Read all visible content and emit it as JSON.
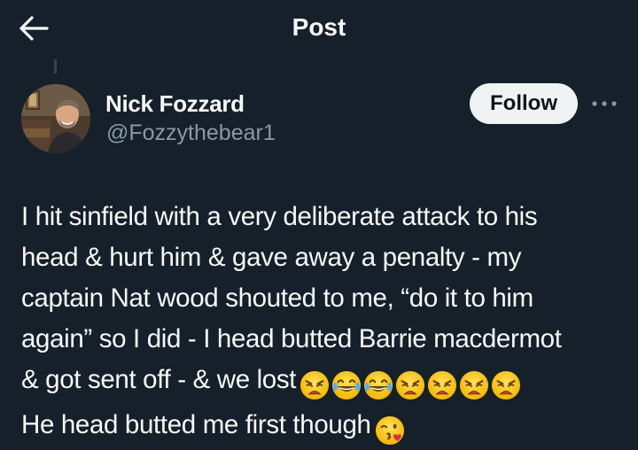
{
  "header": {
    "title": "Post",
    "back_icon": "arrow-left-icon"
  },
  "author": {
    "display_name": "Nick Fozzard",
    "handle": "@Fozzythebear1",
    "avatar_icon": "user-avatar"
  },
  "actions": {
    "follow_label": "Follow",
    "more_icon": "more-horizontal-icon"
  },
  "post": {
    "lines": [
      "I hit sinfield with a very deliberate attack to his",
      "head & hurt him & gave away a penalty - my",
      "captain Nat wood shouted to me, “do it to him",
      "again” so I did - I head butted Barrie macdermot",
      "& got sent off - & we lost",
      "He head butted me first though"
    ],
    "emojis_line5": [
      "weary-face-emoji",
      "tears-of-joy-emoji",
      "tears-of-joy-emoji",
      "weary-face-emoji",
      "weary-face-emoji",
      "weary-face-emoji",
      "weary-face-emoji"
    ],
    "emoji_line6": "face-blowing-kiss-emoji"
  },
  "colors": {
    "background": "#15202b",
    "text": "#f7f9f9",
    "secondary_text": "#8b98a5",
    "follow_bg": "#eff3f4",
    "follow_text": "#0f1419"
  }
}
